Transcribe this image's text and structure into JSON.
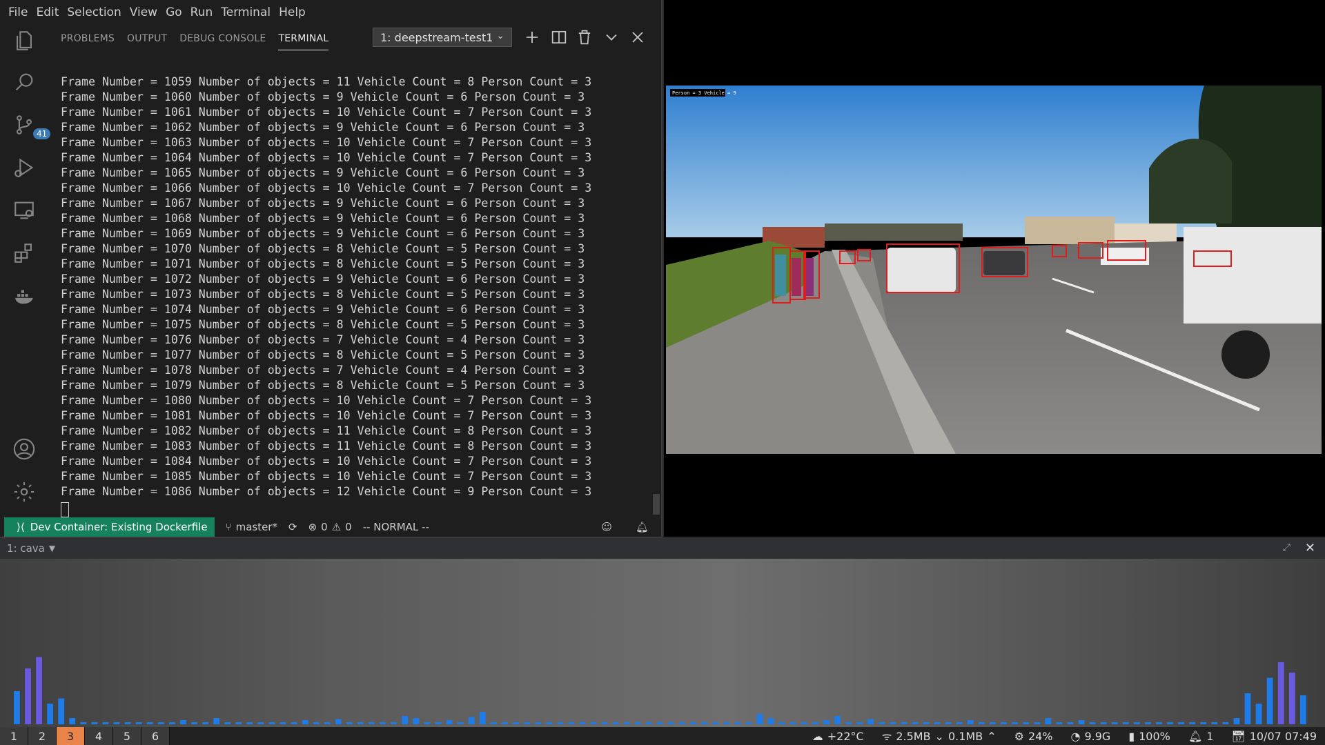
{
  "menu": [
    "File",
    "Edit",
    "Selection",
    "View",
    "Go",
    "Run",
    "Terminal",
    "Help"
  ],
  "activity_badge": "41",
  "panel_tabs": [
    "PROBLEMS",
    "OUTPUT",
    "DEBUG CONSOLE",
    "TERMINAL"
  ],
  "active_tab": "TERMINAL",
  "terminal_select": "1: deepstream-test1",
  "terminal_lines": [
    "Frame Number = 1059 Number of objects = 11 Vehicle Count = 8 Person Count = 3",
    "Frame Number = 1060 Number of objects = 9 Vehicle Count = 6 Person Count = 3",
    "Frame Number = 1061 Number of objects = 10 Vehicle Count = 7 Person Count = 3",
    "Frame Number = 1062 Number of objects = 9 Vehicle Count = 6 Person Count = 3",
    "Frame Number = 1063 Number of objects = 10 Vehicle Count = 7 Person Count = 3",
    "Frame Number = 1064 Number of objects = 10 Vehicle Count = 7 Person Count = 3",
    "Frame Number = 1065 Number of objects = 9 Vehicle Count = 6 Person Count = 3",
    "Frame Number = 1066 Number of objects = 10 Vehicle Count = 7 Person Count = 3",
    "Frame Number = 1067 Number of objects = 9 Vehicle Count = 6 Person Count = 3",
    "Frame Number = 1068 Number of objects = 9 Vehicle Count = 6 Person Count = 3",
    "Frame Number = 1069 Number of objects = 9 Vehicle Count = 6 Person Count = 3",
    "Frame Number = 1070 Number of objects = 8 Vehicle Count = 5 Person Count = 3",
    "Frame Number = 1071 Number of objects = 8 Vehicle Count = 5 Person Count = 3",
    "Frame Number = 1072 Number of objects = 9 Vehicle Count = 6 Person Count = 3",
    "Frame Number = 1073 Number of objects = 8 Vehicle Count = 5 Person Count = 3",
    "Frame Number = 1074 Number of objects = 9 Vehicle Count = 6 Person Count = 3",
    "Frame Number = 1075 Number of objects = 8 Vehicle Count = 5 Person Count = 3",
    "Frame Number = 1076 Number of objects = 7 Vehicle Count = 4 Person Count = 3",
    "Frame Number = 1077 Number of objects = 8 Vehicle Count = 5 Person Count = 3",
    "Frame Number = 1078 Number of objects = 7 Vehicle Count = 4 Person Count = 3",
    "Frame Number = 1079 Number of objects = 8 Vehicle Count = 5 Person Count = 3",
    "Frame Number = 1080 Number of objects = 10 Vehicle Count = 7 Person Count = 3",
    "Frame Number = 1081 Number of objects = 10 Vehicle Count = 7 Person Count = 3",
    "Frame Number = 1082 Number of objects = 11 Vehicle Count = 8 Person Count = 3",
    "Frame Number = 1083 Number of objects = 11 Vehicle Count = 8 Person Count = 3",
    "Frame Number = 1084 Number of objects = 10 Vehicle Count = 7 Person Count = 3",
    "Frame Number = 1085 Number of objects = 10 Vehicle Count = 7 Person Count = 3",
    "Frame Number = 1086 Number of objects = 12 Vehicle Count = 9 Person Count = 3"
  ],
  "statusbar": {
    "remote": "Dev Container: Existing Dockerfile",
    "branch": "master*",
    "errors": "0",
    "warnings": "0",
    "mode": "-- NORMAL --"
  },
  "video": {
    "overlay": "Person = 3 Vehicle = 9",
    "labels": [
      "Person",
      "Person",
      "Person",
      "Car",
      "Car",
      "Car",
      "Car",
      "Car",
      "Car",
      "Car",
      "Car"
    ]
  },
  "cava": {
    "title": "1: cava",
    "bar_color": "#1e7be8",
    "levels": [
      0.32,
      0.54,
      0.65,
      0.2,
      0.25,
      0.06,
      0.02,
      0.02,
      0.02,
      0.02,
      0.02,
      0.02,
      0.02,
      0.02,
      0.02,
      0.04,
      0.02,
      0.02,
      0.06,
      0.02,
      0.02,
      0.02,
      0.02,
      0.02,
      0.02,
      0.02,
      0.04,
      0.02,
      0.02,
      0.05,
      0.02,
      0.02,
      0.02,
      0.02,
      0.02,
      0.08,
      0.06,
      0.02,
      0.02,
      0.04,
      0.02,
      0.07,
      0.12,
      0.02,
      0.02,
      0.02,
      0.02,
      0.02,
      0.02,
      0.02,
      0.02,
      0.02,
      0.02,
      0.02,
      0.02,
      0.02,
      0.02,
      0.02,
      0.02,
      0.02,
      0.02,
      0.02,
      0.02,
      0.02,
      0.02,
      0.02,
      0.02,
      0.1,
      0.06,
      0.02,
      0.02,
      0.02,
      0.02,
      0.04,
      0.08,
      0.02,
      0.02,
      0.05,
      0.02,
      0.02,
      0.02,
      0.02,
      0.02,
      0.02,
      0.02,
      0.02,
      0.04,
      0.02,
      0.02,
      0.02,
      0.02,
      0.02,
      0.02,
      0.06,
      0.02,
      0.02,
      0.04,
      0.02,
      0.02,
      0.02,
      0.02,
      0.02,
      0.02,
      0.02,
      0.02,
      0.02,
      0.02,
      0.02,
      0.02,
      0.02,
      0.06,
      0.3,
      0.2,
      0.45,
      0.6,
      0.5,
      0.28
    ]
  },
  "workspaces": [
    "1",
    "2",
    "3",
    "4",
    "5",
    "6"
  ],
  "active_workspace": "3",
  "system": {
    "weather": "+22°C",
    "download": "2.5MB",
    "upload": "0.1MB",
    "cpu": "24%",
    "memory": "9.9G",
    "battery": "100%",
    "notifications": "1",
    "datetime": "10/07 07:49"
  }
}
